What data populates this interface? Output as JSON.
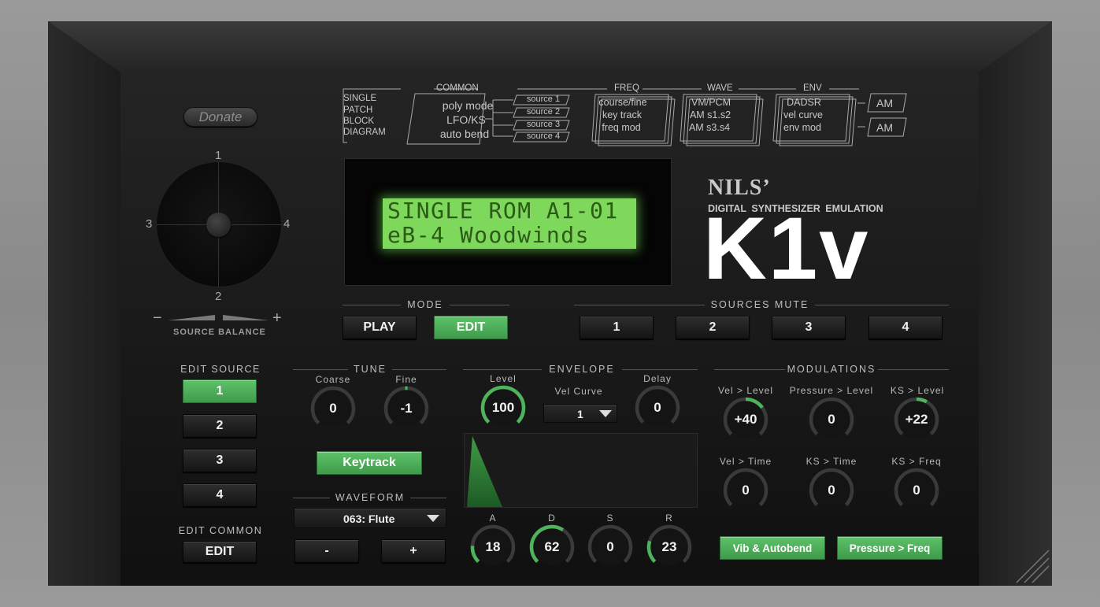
{
  "donate": "Donate",
  "diagram": {
    "title_lines": [
      "SINGLE",
      "PATCH",
      "BLOCK",
      "DIAGRAM"
    ],
    "common_title": "COMMON",
    "common_lines": [
      "poly mode",
      "LFO/KS",
      "auto bend"
    ],
    "sources": [
      "source 1",
      "source 2",
      "source 3",
      "source 4"
    ],
    "freq_title": "FREQ",
    "freq_lines": [
      "course/fine",
      "key track",
      "freq mod"
    ],
    "wave_title": "WAVE",
    "wave_lines": [
      "VM/PCM",
      "AM s1.s2",
      "AM s3.s4"
    ],
    "env_title": "ENV",
    "env_lines": [
      "DADSR",
      "vel curve",
      "env mod"
    ],
    "am": [
      "AM",
      "AM"
    ]
  },
  "joystick": {
    "top": "1",
    "bottom": "2",
    "left": "3",
    "right": "4",
    "minus": "−",
    "plus": "+",
    "label": "SOURCE BALANCE"
  },
  "lcd": {
    "line1": "SINGLE ROM A1-01",
    "line2": "eB-4  Woodwinds"
  },
  "brand": {
    "maker": "NILS’",
    "subtitle": "DIGITAL SYNTHESIZER EMULATION",
    "name": "K1v"
  },
  "mode": {
    "title": "MODE",
    "play": "PLAY",
    "edit": "EDIT"
  },
  "mute": {
    "title": "SOURCES MUTE",
    "buttons": [
      "1",
      "2",
      "3",
      "4"
    ]
  },
  "edit_source": {
    "title": "EDIT SOURCE",
    "buttons": [
      "1",
      "2",
      "3",
      "4"
    ]
  },
  "edit_common": {
    "title": "EDIT COMMON",
    "button": "EDIT"
  },
  "tune": {
    "title": "TUNE",
    "coarse_label": "Coarse",
    "coarse": "0",
    "fine_label": "Fine",
    "fine": "-1",
    "keytrack": "Keytrack"
  },
  "waveform": {
    "title": "WAVEFORM",
    "value": "063: Flute",
    "minus": "-",
    "plus": "+"
  },
  "envelope": {
    "title": "ENVELOPE",
    "level_label": "Level",
    "level": "100",
    "vel_curve_label": "Vel Curve",
    "vel_curve": "1",
    "delay_label": "Delay",
    "delay": "0",
    "a_label": "A",
    "a": "18",
    "d_label": "D",
    "d": "62",
    "s_label": "S",
    "s": "0",
    "r_label": "R",
    "r": "23"
  },
  "modulations": {
    "title": "MODULATIONS",
    "vel_level_label": "Vel > Level",
    "vel_level": "+40",
    "pressure_level_label": "Pressure > Level",
    "pressure_level": "0",
    "ks_level_label": "KS > Level",
    "ks_level": "+22",
    "vel_time_label": "Vel > Time",
    "vel_time": "0",
    "ks_time_label": "KS > Time",
    "ks_time": "0",
    "ks_freq_label": "KS > Freq",
    "ks_freq": "0",
    "vib_button": "Vib & Autobend",
    "pressure_button": "Pressure > Freq"
  },
  "colors": {
    "accent": "#4fb35b",
    "lcd": "#7ed85c",
    "panel": "#161616"
  }
}
